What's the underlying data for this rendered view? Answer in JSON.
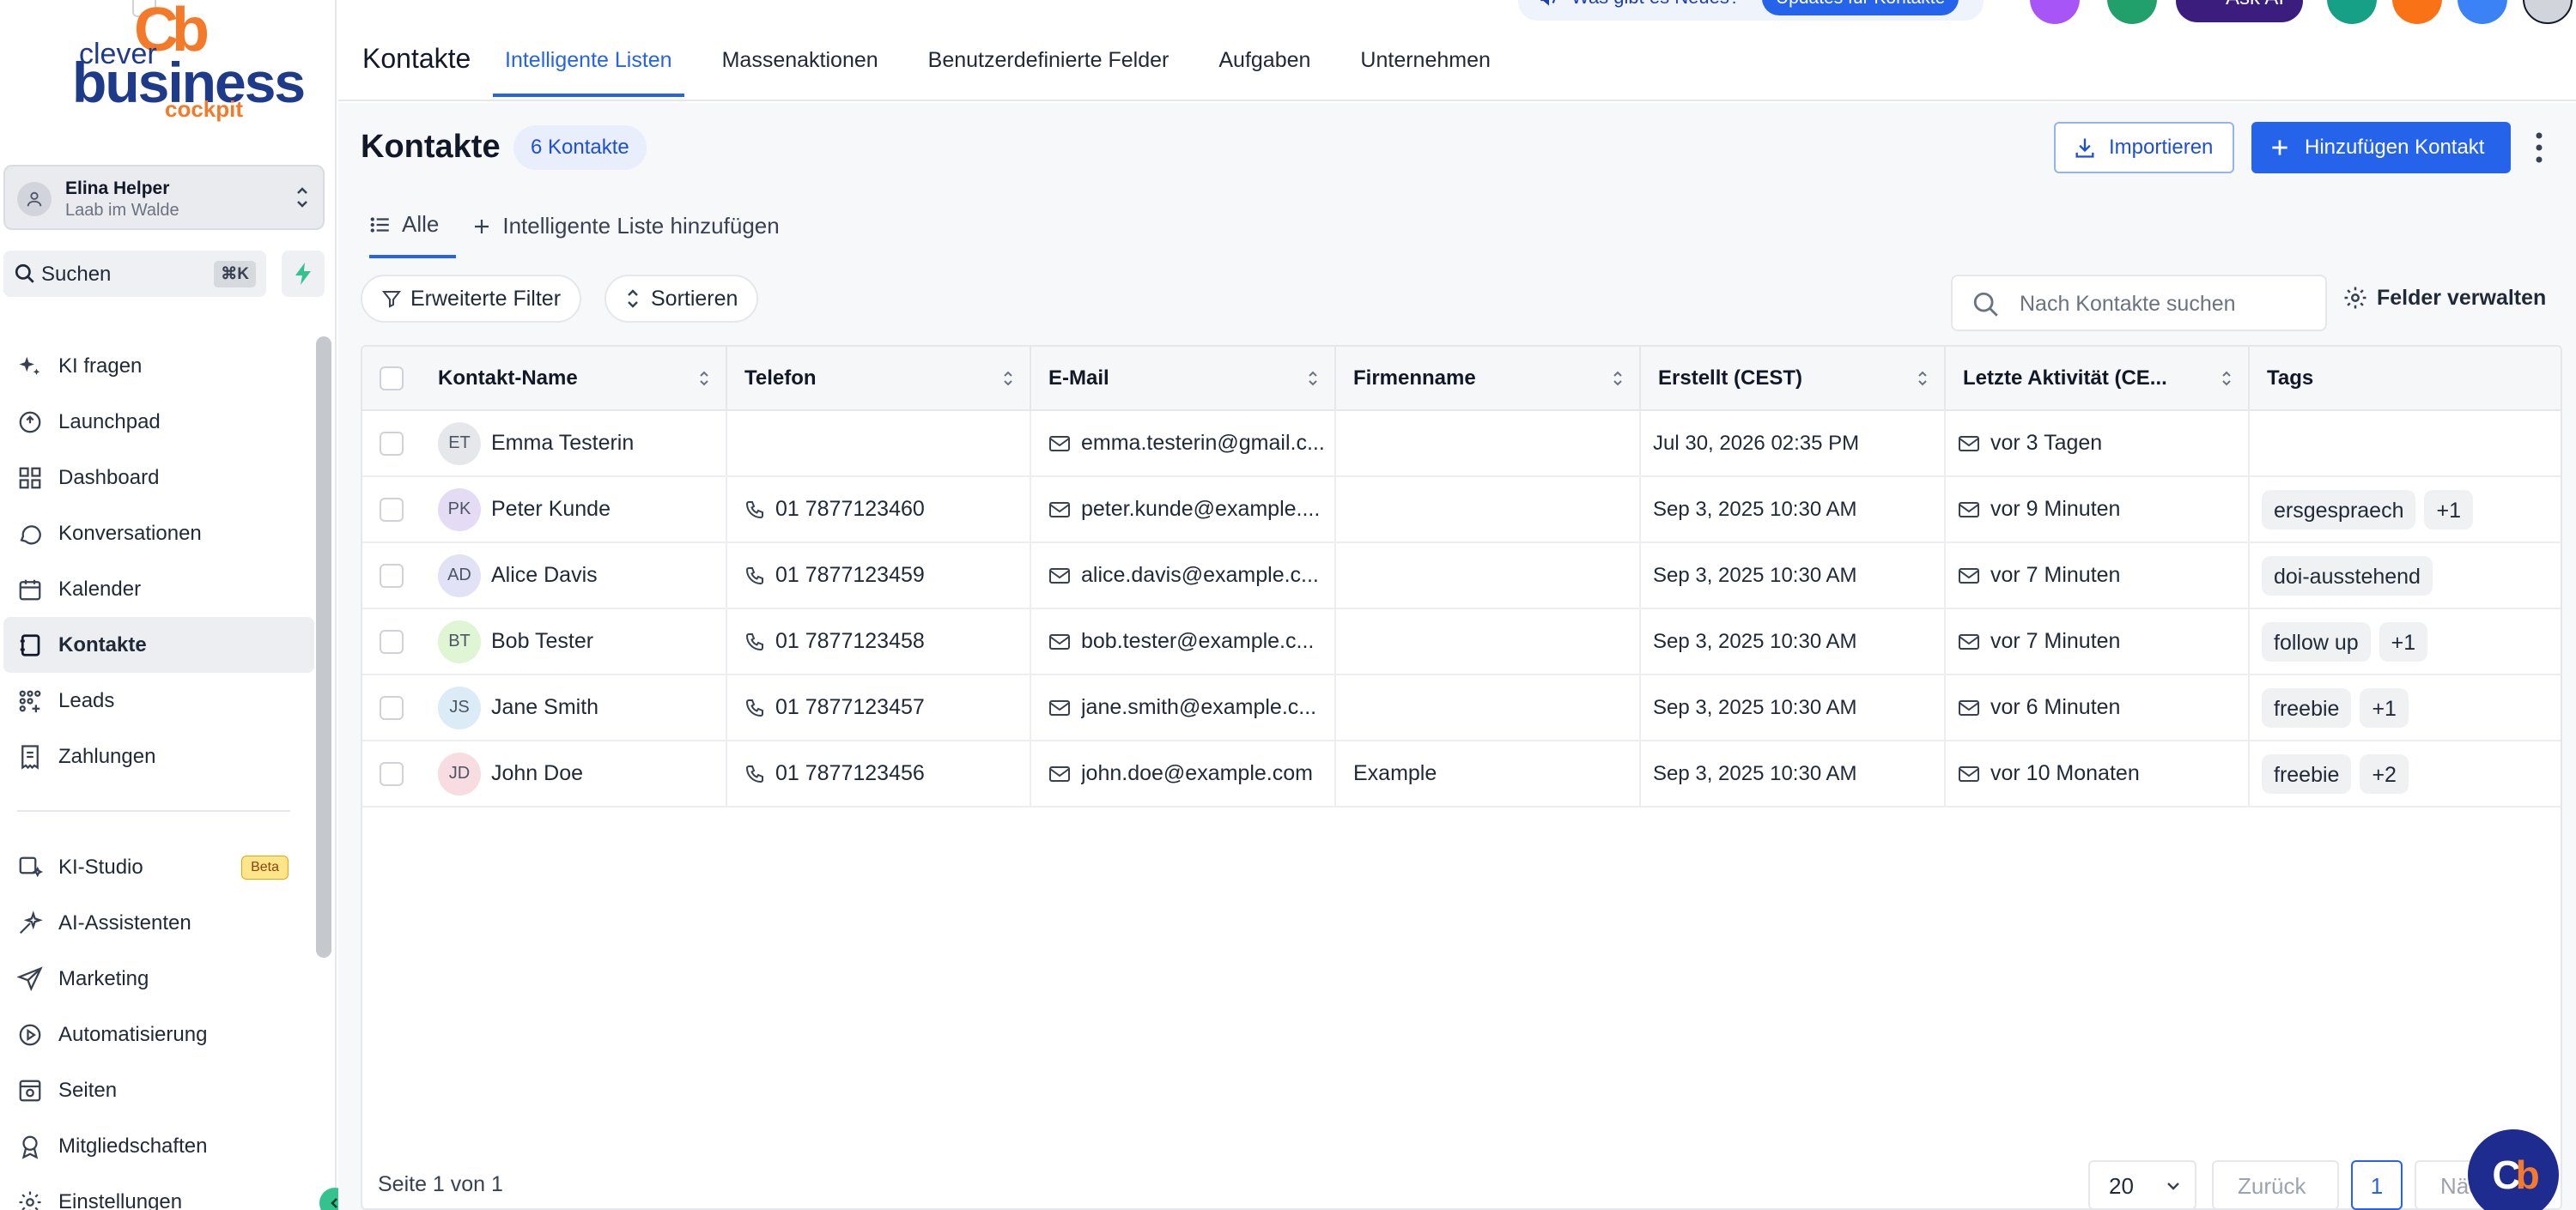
{
  "brand": {
    "logo_top": "Cb",
    "logo_small": "clever",
    "logo_main": "business",
    "logo_sub": "cockpit"
  },
  "account": {
    "name": "Elina Helper",
    "location": "Laab im Walde"
  },
  "sidebar_search": {
    "label": "Suchen",
    "shortcut": "⌘K"
  },
  "nav": {
    "items": [
      {
        "label": "KI fragen",
        "icon": "sparkle-icon"
      },
      {
        "label": "Launchpad",
        "icon": "rocket-icon"
      },
      {
        "label": "Dashboard",
        "icon": "grid-icon"
      },
      {
        "label": "Konversationen",
        "icon": "chat-icon"
      },
      {
        "label": "Kalender",
        "icon": "calendar-icon"
      },
      {
        "label": "Kontakte",
        "icon": "contacts-icon",
        "active": true
      },
      {
        "label": "Leads",
        "icon": "leads-icon"
      },
      {
        "label": "Zahlungen",
        "icon": "receipt-icon"
      }
    ],
    "items2": [
      {
        "label": "KI-Studio",
        "icon": "studio-icon",
        "badge": "Beta"
      },
      {
        "label": "AI-Assistenten",
        "icon": "assistant-icon"
      },
      {
        "label": "Marketing",
        "icon": "send-icon"
      },
      {
        "label": "Automatisierung",
        "icon": "automation-icon"
      },
      {
        "label": "Seiten",
        "icon": "pages-icon"
      },
      {
        "label": "Mitgliedschaften",
        "icon": "badge-icon"
      },
      {
        "label": "Einstellungen",
        "icon": "gear-icon"
      }
    ]
  },
  "topbar": {
    "title": "Kontakte",
    "tabs": [
      "Intelligente Listen",
      "Massenaktionen",
      "Benutzerdefinierte Felder",
      "Aufgaben",
      "Unternehmen"
    ],
    "news_text": "Was gibt es Neues?",
    "news_button": "Updates für Kontakte",
    "ask_ai": "Ask AI"
  },
  "page": {
    "heading": "Kontakte",
    "count_badge": "6 Kontakte",
    "import_label": "Importieren",
    "add_label": "Hinzufügen Kontakt",
    "subtab_all": "Alle",
    "subtab_add": "Intelligente Liste hinzufügen",
    "filter_label": "Erweiterte Filter",
    "sort_label": "Sortieren",
    "search_placeholder": "Nach Kontakte suchen",
    "manage_fields": "Felder verwalten"
  },
  "table": {
    "columns": [
      "Kontakt-Name",
      "Telefon",
      "E-Mail",
      "Firmenname",
      "Erstellt (CEST)",
      "Letzte Aktivität (CE...",
      "Tags"
    ],
    "rows": [
      {
        "initials": "ET",
        "avatar_color": "#e5e7eb",
        "name": "Emma Testerin",
        "phone": "",
        "email": "emma.testerin@gmail.c...",
        "company": "",
        "created": "Jul 30, 2026 02:35 PM",
        "activity": "vor 3 Tagen",
        "tags": []
      },
      {
        "initials": "PK",
        "avatar_color": "#e4dcf5",
        "name": "Peter Kunde",
        "phone": "01 7877123460",
        "email": "peter.kunde@example....",
        "company": "",
        "created": "Sep 3, 2025 10:30 AM",
        "activity": "vor 9 Minuten",
        "tags": [
          "ersgespraech",
          "+1"
        ]
      },
      {
        "initials": "AD",
        "avatar_color": "#e1e2f5",
        "name": "Alice Davis",
        "phone": "01 7877123459",
        "email": "alice.davis@example.c...",
        "company": "",
        "created": "Sep 3, 2025 10:30 AM",
        "activity": "vor 7 Minuten",
        "tags": [
          "doi-ausstehend"
        ]
      },
      {
        "initials": "BT",
        "avatar_color": "#dff5d3",
        "name": "Bob Tester",
        "phone": "01 7877123458",
        "email": "bob.tester@example.c...",
        "company": "",
        "created": "Sep 3, 2025 10:30 AM",
        "activity": "vor 7 Minuten",
        "tags": [
          "follow up",
          "+1"
        ]
      },
      {
        "initials": "JS",
        "avatar_color": "#dcecf7",
        "name": "Jane Smith",
        "phone": "01 7877123457",
        "email": "jane.smith@example.c...",
        "company": "",
        "created": "Sep 3, 2025 10:30 AM",
        "activity": "vor 6 Minuten",
        "tags": [
          "freebie",
          "+1"
        ]
      },
      {
        "initials": "JD",
        "avatar_color": "#f7dde1",
        "name": "John Doe",
        "phone": "01 7877123456",
        "email": "john.doe@example.com",
        "company": "Example",
        "created": "Sep 3, 2025 10:30 AM",
        "activity": "vor 10 Monaten",
        "tags": [
          "freebie",
          "+2"
        ]
      }
    ]
  },
  "pagination": {
    "page_text": "Seite 1 von 1",
    "page_size": "20",
    "prev": "Zurück",
    "current": "1",
    "next": "Nächste"
  },
  "fab": {
    "label_a": "C",
    "label_b": "b"
  }
}
